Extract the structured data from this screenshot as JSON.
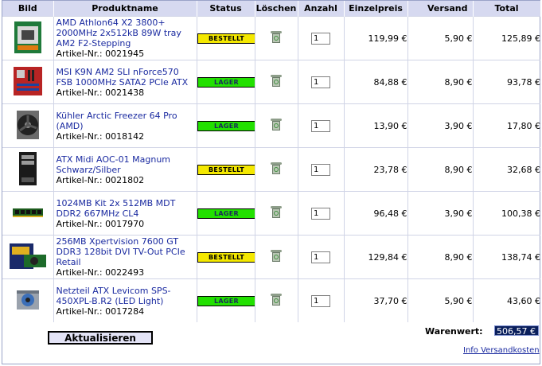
{
  "table": {
    "headers": {
      "image": "Bild",
      "name": "Produktname",
      "status": "Status",
      "delete": "Löschen",
      "qty": "Anzahl",
      "unit_price": "Einzelpreis",
      "shipping": "Versand",
      "total": "Total"
    },
    "rows": [
      {
        "name": "AMD Athlon64 X2 3800+ 2000MHz 2x512kB 89W tray AM2 F2-Stepping",
        "article": "Artikel-Nr.: 0021945",
        "status": "BESTELLT",
        "status_color": "yellow",
        "qty": "1",
        "unit_price": "119,99 €",
        "shipping": "5,90 €",
        "total": "125,89 €",
        "image_icon": "cpu-box-icon"
      },
      {
        "name": "MSI K9N AM2 SLI nForce570 FSB 1000MHz SATA2 PCIe ATX",
        "article": "Artikel-Nr.: 0021438",
        "status": "LAGER",
        "status_color": "green",
        "qty": "1",
        "unit_price": "84,88 €",
        "shipping": "8,90 €",
        "total": "93,78 €",
        "image_icon": "mainboard-icon"
      },
      {
        "name": "Kühler Arctic Freezer 64 Pro (AMD)",
        "article": "Artikel-Nr.: 0018142",
        "status": "LAGER",
        "status_color": "green",
        "qty": "1",
        "unit_price": "13,90 €",
        "shipping": "3,90 €",
        "total": "17,80 €",
        "image_icon": "cpu-cooler-icon"
      },
      {
        "name": "ATX Midi AOC-01 Magnum Schwarz/Silber",
        "article": "Artikel-Nr.: 0021802",
        "status": "BESTELLT",
        "status_color": "yellow",
        "qty": "1",
        "unit_price": "23,78 €",
        "shipping": "8,90 €",
        "total": "32,68 €",
        "image_icon": "pc-case-icon"
      },
      {
        "name": "1024MB Kit 2x 512MB MDT DDR2 667MHz CL4",
        "article": "Artikel-Nr.: 0017970",
        "status": "LAGER",
        "status_color": "green",
        "qty": "1",
        "unit_price": "96,48 €",
        "shipping": "3,90 €",
        "total": "100,38 €",
        "image_icon": "ram-module-icon"
      },
      {
        "name": "256MB Xpertvision 7600 GT DDR3 128bit DVI TV-Out PCIe Retail",
        "article": "Artikel-Nr.: 0022493",
        "status": "BESTELLT",
        "status_color": "yellow",
        "qty": "1",
        "unit_price": "129,84 €",
        "shipping": "8,90 €",
        "total": "138,74 €",
        "image_icon": "graphics-card-box-icon"
      },
      {
        "name": "Netzteil ATX Levicom SPS-450XPL-B.R2 (LED Light)",
        "article": "Artikel-Nr.: 0017284",
        "status": "LAGER",
        "status_color": "green",
        "qty": "1",
        "unit_price": "37,70 €",
        "shipping": "5,90 €",
        "total": "43,60 €",
        "image_icon": "power-supply-icon"
      }
    ]
  },
  "footer": {
    "update_label": "Aktualisieren",
    "goods_value_label": "Warenwert:",
    "goods_value": "506,57 €",
    "shipping_info_link": "Info Versandkosten"
  },
  "colors": {
    "header_bg": "#d6d9f0",
    "status_yellow": "#f4e800",
    "status_green": "#22e000",
    "link": "#1a2aa0",
    "total_bg": "#0a1f5c"
  }
}
